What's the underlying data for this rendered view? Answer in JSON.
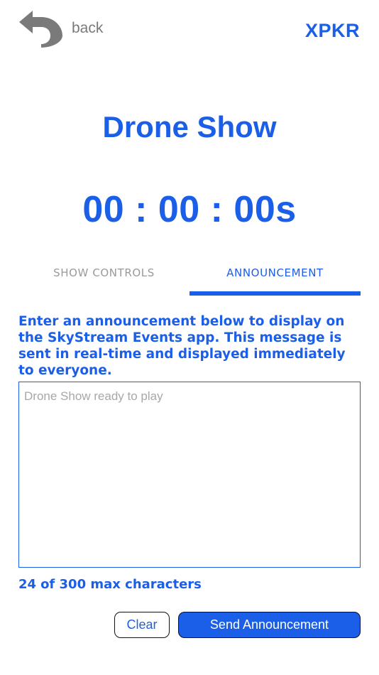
{
  "header": {
    "back_label": "back",
    "back_icon": "undo-arrow-icon",
    "brand": "XPKR"
  },
  "page": {
    "title": "Drone Show",
    "timer": "00 : 00 : 00s"
  },
  "tabs": [
    {
      "label": "SHOW CONTROLS",
      "active": false
    },
    {
      "label": "ANNOUNCEMENT",
      "active": true
    }
  ],
  "announcement": {
    "instructions": "Enter an announcement below to display on the SkyStream Events app. This message is sent in real-time and displayed immediately to everyone.",
    "message_value": "",
    "placeholder": "Drone Show ready to play",
    "char_count": "24",
    "char_limit_text": "of 300 max characters"
  },
  "actions": {
    "clear_label": "Clear",
    "send_label": "Send Announcement"
  },
  "colors": {
    "accent": "#1b5ee8",
    "muted": "#9a9a9a",
    "back_icon": "#7a7a7a"
  }
}
